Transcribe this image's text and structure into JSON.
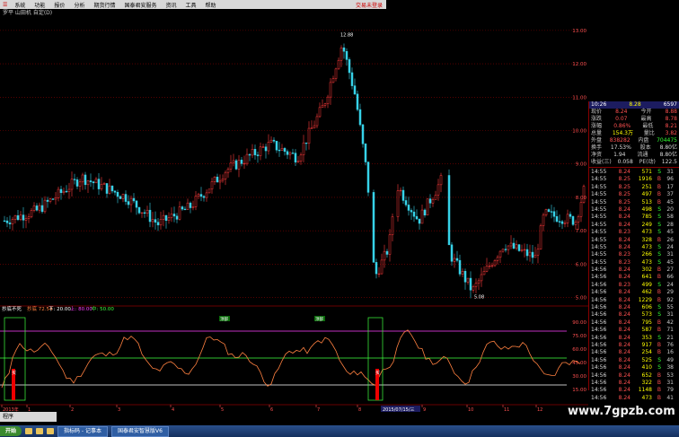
{
  "menubar": {
    "logo": "☰",
    "items": [
      "系统",
      "功能",
      "报价",
      "分析",
      "期货行情",
      "国泰君安服务",
      "资讯",
      "工具",
      "帮助"
    ],
    "right_text": "交易未登录"
  },
  "title": "罗平 山田机 自定(D)",
  "price_axis": [
    "13.00",
    "12.00",
    "11.00",
    "10.00",
    "9.00",
    "8.00",
    "7.00",
    "6.00",
    "5.00"
  ],
  "high_label": "12.88",
  "low_label": "5.08",
  "indicator": {
    "name": "抄底不死",
    "items": [
      {
        "text": "抄底 72.54",
        "color": "#ff8040"
      },
      {
        "text": "下: 20.00",
        "color": "#ffffff"
      },
      {
        "text": "上: 80.00",
        "color": "#ff40ff"
      },
      {
        "text": "中: 50.00",
        "color": "#40ff40"
      }
    ],
    "axis": [
      "90.00",
      "75.00",
      "60.00",
      "45.00",
      "30.00",
      "15.00"
    ],
    "labels": [
      "顶部",
      "顶部"
    ],
    "levels": [
      20,
      50,
      80
    ],
    "buy_labels": [
      "买",
      "买"
    ]
  },
  "date_axis": [
    "2013年",
    "1",
    "2",
    "3",
    "4",
    "5",
    "6",
    "7",
    "8",
    "9",
    "10",
    "11",
    "12"
  ],
  "date_highlight": "2015/07/15/三",
  "quote": {
    "time": "10:26",
    "price_header": "8.28",
    "code_header": "6597",
    "rows": [
      {
        "l1": "现价",
        "v1": "8.24",
        "l2": "今开",
        "v2": "8.88",
        "c1": "red",
        "c2": "red"
      },
      {
        "l1": "涨跌",
        "v1": "0.07",
        "l2": "最高",
        "v2": "8.78",
        "c1": "red",
        "c2": "red"
      },
      {
        "l1": "涨幅",
        "v1": "0.86%",
        "l2": "最低",
        "v2": "8.21",
        "c1": "red",
        "c2": "red"
      },
      {
        "l1": "总量",
        "v1": "154.3万",
        "l2": "量比",
        "v2": "3.82",
        "c1": "yel",
        "c2": "red"
      },
      {
        "l1": "外盘",
        "v1": "838282",
        "l2": "内盘",
        "v2": "704475",
        "c1": "red",
        "c2": "grn"
      },
      {
        "l1": "换手",
        "v1": "17.53%",
        "l2": "股本",
        "v2": "8.80亿",
        "c1": "wht",
        "c2": "wht"
      },
      {
        "l1": "净资",
        "v1": "1.94",
        "l2": "流通",
        "v2": "8.80亿",
        "c1": "wht",
        "c2": "wht"
      },
      {
        "l1": "收益(三)",
        "v1": "0.058",
        "l2": "PE(动)",
        "v2": "122.5",
        "c1": "wht",
        "c2": "wht"
      }
    ],
    "ticks": [
      {
        "t": "14:55",
        "p": "8.24",
        "v": "571",
        "s": "S",
        "n": "31"
      },
      {
        "t": "14:55",
        "p": "8.25",
        "v": "1916",
        "s": "B",
        "n": "96"
      },
      {
        "t": "14:55",
        "p": "8.25",
        "v": "251",
        "s": "B",
        "n": "17"
      },
      {
        "t": "14:55",
        "p": "8.25",
        "v": "497",
        "s": "B",
        "n": "37"
      },
      {
        "t": "14:55",
        "p": "8.25",
        "v": "513",
        "s": "B",
        "n": "45"
      },
      {
        "t": "14:55",
        "p": "8.24",
        "v": "498",
        "s": "S",
        "n": "20"
      },
      {
        "t": "14:55",
        "p": "8.24",
        "v": "785",
        "s": "S",
        "n": "58"
      },
      {
        "t": "14:55",
        "p": "8.24",
        "v": "249",
        "s": "S",
        "n": "28"
      },
      {
        "t": "14:55",
        "p": "8.23",
        "v": "473",
        "s": "S",
        "n": "45"
      },
      {
        "t": "14:55",
        "p": "8.24",
        "v": "328",
        "s": "B",
        "n": "26"
      },
      {
        "t": "14:55",
        "p": "8.24",
        "v": "473",
        "s": "S",
        "n": "24"
      },
      {
        "t": "14:55",
        "p": "8.23",
        "v": "266",
        "s": "S",
        "n": "31"
      },
      {
        "t": "14:55",
        "p": "8.23",
        "v": "473",
        "s": "S",
        "n": "45"
      },
      {
        "t": "14:56",
        "p": "8.24",
        "v": "302",
        "s": "B",
        "n": "27"
      },
      {
        "t": "14:56",
        "p": "8.24",
        "v": "641",
        "s": "B",
        "n": "66"
      },
      {
        "t": "14:56",
        "p": "8.23",
        "v": "499",
        "s": "S",
        "n": "24"
      },
      {
        "t": "14:56",
        "p": "8.24",
        "v": "462",
        "s": "B",
        "n": "29"
      },
      {
        "t": "14:56",
        "p": "8.24",
        "v": "1229",
        "s": "B",
        "n": "92"
      },
      {
        "t": "14:56",
        "p": "8.24",
        "v": "606",
        "s": "S",
        "n": "55"
      },
      {
        "t": "14:56",
        "p": "8.24",
        "v": "573",
        "s": "S",
        "n": "31"
      },
      {
        "t": "14:56",
        "p": "8.24",
        "v": "795",
        "s": "B",
        "n": "42"
      },
      {
        "t": "14:56",
        "p": "8.24",
        "v": "587",
        "s": "B",
        "n": "71"
      },
      {
        "t": "14:56",
        "p": "8.24",
        "v": "353",
        "s": "S",
        "n": "21"
      },
      {
        "t": "14:56",
        "p": "8.24",
        "v": "917",
        "s": "B",
        "n": "76"
      },
      {
        "t": "14:56",
        "p": "8.24",
        "v": "254",
        "s": "B",
        "n": "16"
      },
      {
        "t": "14:56",
        "p": "8.24",
        "v": "525",
        "s": "S",
        "n": "49"
      },
      {
        "t": "14:56",
        "p": "8.24",
        "v": "410",
        "s": "S",
        "n": "38"
      },
      {
        "t": "14:56",
        "p": "8.24",
        "v": "652",
        "s": "B",
        "n": "53"
      },
      {
        "t": "14:56",
        "p": "8.24",
        "v": "322",
        "s": "B",
        "n": "31"
      },
      {
        "t": "14:56",
        "p": "8.24",
        "v": "1148",
        "s": "B",
        "n": "79"
      },
      {
        "t": "14:56",
        "p": "8.24",
        "v": "473",
        "s": "B",
        "n": "41"
      }
    ]
  },
  "watermark": "www.7gpzb.com",
  "floatbox": "程序",
  "taskbar": {
    "start": "开始",
    "tasks": [
      "指标码 - 记事本",
      "国泰君安智慧版V6"
    ]
  },
  "colors": {
    "up": "#ff3b3b",
    "down": "#36d2e8",
    "indicator_line": "#ff8040",
    "grid": "#8a0000",
    "top_line": "#ff40ff",
    "mid_line": "#40ff40",
    "low_line": "#ffffff"
  }
}
